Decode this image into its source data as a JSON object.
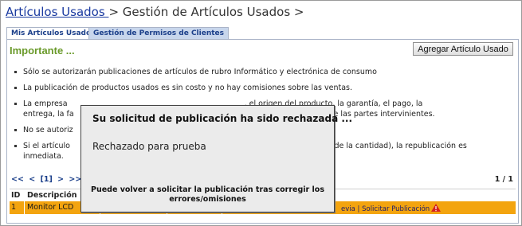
{
  "breadcrumb": {
    "link": "Artículos Usados ",
    "separator": ">",
    "current": "Gestión de Artículos Usados >"
  },
  "tabs": [
    {
      "label": "Mis Artículos Usados",
      "active": true
    },
    {
      "label": "Gestión de Permisos de Clientes",
      "active": false
    }
  ],
  "section": {
    "heading": "Importante ...",
    "add_button": "Agregar Artículo Usado"
  },
  "rules": [
    "Sólo se autorizarán publicaciones de artículos de rubro Informático y electrónica de consumo",
    "La publicación de productos usados es sin costo y no hay comisiones sobre las ventas.",
    "La empresa ... , el origen del producto, la garantía, el pago, la entrega, la fa... responsabilidad de las partes intervinientes.",
    "No se autoriz...",
    "Si el artículo ... oción de la cantidad), la republicación es inmediata."
  ],
  "rules_visible": {
    "r3a": "La empresa",
    "r3b": ", el origen del producto, la garantía, el pago, la",
    "r3c": "entrega, la fa",
    "r3d": "a responsabilidad de las partes intervinientes.",
    "r4": "No se autoriz",
    "r5a": "Si el artículo",
    "r5b": "oción de la cantidad), la republicación es",
    "r5c": "inmediata."
  },
  "pager": {
    "first": "<<",
    "prev": "<",
    "current": "[1]",
    "next": ">",
    "last": ">>",
    "count": "1 / 1"
  },
  "table": {
    "headers": {
      "id": "ID",
      "descripcion": "Descripción"
    },
    "rows": [
      {
        "id": "1",
        "descripcion": "Monitor LCD",
        "links_tail": "evia | Solicitar Publicación"
      }
    ]
  },
  "modal": {
    "title": "Su solicitud de publicación ha sido rechazada ...",
    "reason": "Rechazado para prueba",
    "message": "Puede volver a solicitar la publicación tras corregir los errores/omisiones"
  },
  "colors": {
    "row_highlight": "#f3a40f",
    "heading_green": "#6a9a2a",
    "link_blue": "#1a3aa0",
    "warning": "#d42020"
  },
  "icons": [
    "warning-icon"
  ]
}
